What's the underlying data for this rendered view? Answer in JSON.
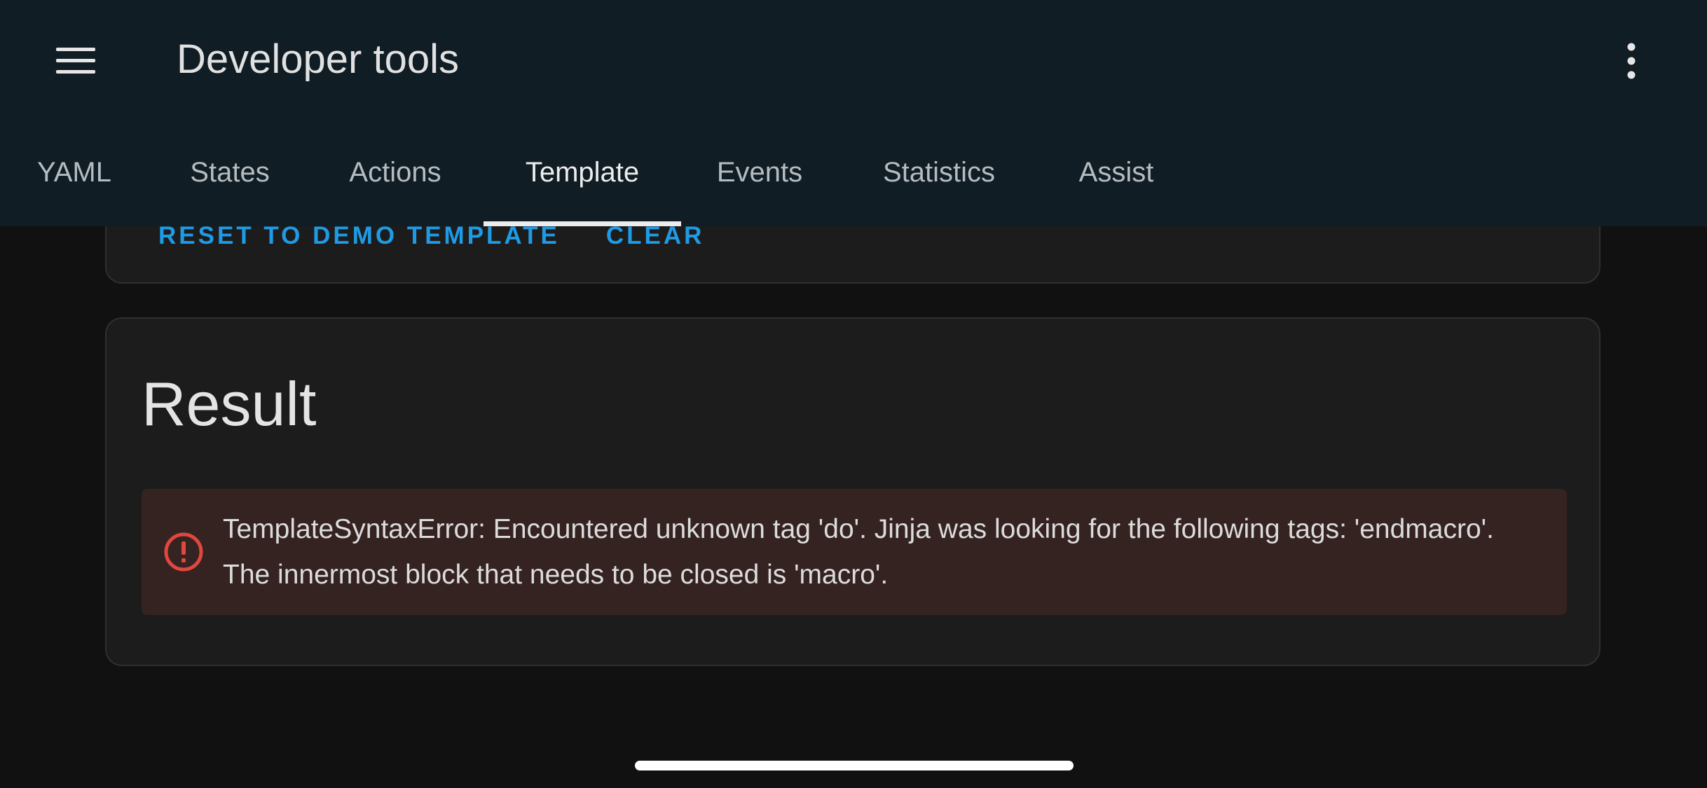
{
  "header": {
    "title": "Developer tools",
    "menu_icon": "hamburger-menu-icon",
    "overflow_icon": "vertical-dots-icon"
  },
  "tabs": [
    {
      "label": "YAML",
      "active": false
    },
    {
      "label": "States",
      "active": false
    },
    {
      "label": "Actions",
      "active": false
    },
    {
      "label": "Template",
      "active": true
    },
    {
      "label": "Events",
      "active": false
    },
    {
      "label": "Statistics",
      "active": false
    },
    {
      "label": "Assist",
      "active": false
    }
  ],
  "template_card": {
    "reset_label": "Reset to demo template",
    "clear_label": "Clear"
  },
  "result_card": {
    "title": "Result",
    "error": {
      "icon": "alert-circle-icon",
      "message": "TemplateSyntaxError: Encountered unknown tag 'do'. Jinja was looking for the following tags: 'endmacro'. The innermost block that needs to be closed is 'macro'."
    }
  },
  "colors": {
    "header_bg": "#101d24",
    "page_bg": "#111111",
    "card_bg": "#1c1c1c",
    "accent": "#1e9be6",
    "error_bg": "#352322",
    "error_icon": "#e0473e"
  }
}
